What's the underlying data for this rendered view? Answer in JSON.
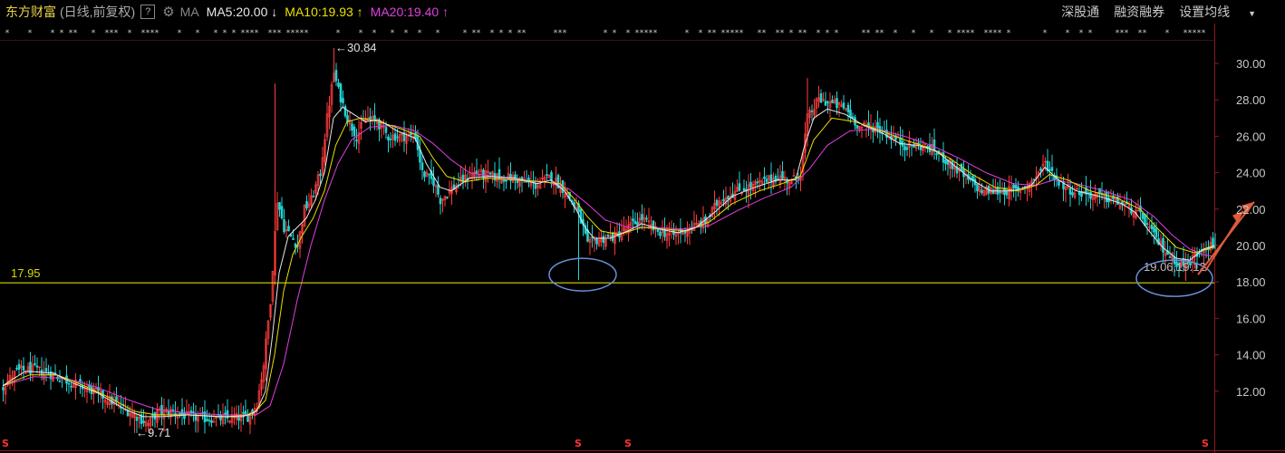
{
  "toolbar": {
    "stock_name": "东方财富",
    "mode": "(日线,前复权)",
    "help_label": "?",
    "ma_label": "MA",
    "ma5": "MA5:20.00",
    "ma5_arrow": "↓",
    "ma10": "MA10:19.93",
    "ma10_arrow": "↑",
    "ma20": "MA20:19.40",
    "ma20_arrow": "↑",
    "right_buttons": [
      "深股通",
      "融资融券",
      "设置均线"
    ],
    "dropdown_arrow": "▼",
    "gear_icon": "gear-icon"
  },
  "colors": {
    "up": "#ff3b3b",
    "down": "#22d3d3",
    "ma5": "#e8e8e8",
    "ma10": "#e8e000",
    "ma20": "#e040e0",
    "support_line": "#d8d800",
    "ellipse": "#6a8fd8",
    "arrow": "#e05a3a",
    "axis": "#8b1a1a"
  },
  "chart_data": {
    "type": "candlestick",
    "y_ticks": [
      "30.00",
      "28.00",
      "26.00",
      "24.00",
      "22.00",
      "20.00",
      "18.00",
      "16.00",
      "14.00",
      "12.00"
    ],
    "ylim": [
      10.6,
      32.0
    ],
    "grid": false,
    "support_level": 17.95,
    "support_label": "17.95",
    "max_annotation": {
      "label": "←30.84",
      "value": 30.84
    },
    "min_annotation": {
      "label": "←9.71",
      "value": 9.71
    },
    "right_annotation": "19.06,19.12",
    "ma_latest": {
      "MA5": 20.0,
      "MA10": 19.93,
      "MA20": 19.4
    },
    "close_anchors": [
      [
        0,
        12.3
      ],
      [
        6,
        13.1
      ],
      [
        14,
        13.2
      ],
      [
        22,
        12.9
      ],
      [
        30,
        12.5
      ],
      [
        40,
        12.0
      ],
      [
        50,
        11.3
      ],
      [
        58,
        10.7
      ],
      [
        64,
        10.2
      ],
      [
        68,
        10.8
      ],
      [
        74,
        10.9
      ],
      [
        82,
        10.6
      ],
      [
        90,
        10.5
      ],
      [
        100,
        10.5
      ],
      [
        108,
        10.6
      ],
      [
        112,
        11.3
      ],
      [
        115,
        13.5
      ],
      [
        118,
        17.0
      ],
      [
        121,
        22.5
      ],
      [
        124,
        21.0
      ],
      [
        127,
        20.5
      ],
      [
        130,
        20.0
      ],
      [
        133,
        22.0
      ],
      [
        136,
        22.5
      ],
      [
        140,
        24.0
      ],
      [
        143,
        27.0
      ],
      [
        146,
        29.5
      ],
      [
        148,
        28.5
      ],
      [
        152,
        27.0
      ],
      [
        156,
        26.0
      ],
      [
        160,
        27.0
      ],
      [
        165,
        26.8
      ],
      [
        170,
        26.0
      ],
      [
        176,
        26.0
      ],
      [
        182,
        26.0
      ],
      [
        185,
        24.0
      ],
      [
        190,
        23.5
      ],
      [
        193,
        22.5
      ],
      [
        197,
        23.0
      ],
      [
        202,
        23.5
      ],
      [
        208,
        24.0
      ],
      [
        216,
        23.8
      ],
      [
        225,
        23.7
      ],
      [
        235,
        23.3
      ],
      [
        242,
        23.8
      ],
      [
        248,
        23.0
      ],
      [
        253,
        22.0
      ],
      [
        256,
        21.0
      ],
      [
        258,
        20.0
      ],
      [
        262,
        20.3
      ],
      [
        270,
        20.5
      ],
      [
        276,
        21.0
      ],
      [
        282,
        21.5
      ],
      [
        288,
        20.8
      ],
      [
        296,
        20.6
      ],
      [
        304,
        21.0
      ],
      [
        310,
        21.3
      ],
      [
        316,
        22.5
      ],
      [
        324,
        23.0
      ],
      [
        334,
        23.4
      ],
      [
        342,
        23.8
      ],
      [
        348,
        23.5
      ],
      [
        352,
        24.0
      ],
      [
        355,
        27.0
      ],
      [
        360,
        28.0
      ],
      [
        366,
        27.8
      ],
      [
        372,
        27.5
      ],
      [
        378,
        26.5
      ],
      [
        385,
        26.5
      ],
      [
        392,
        26.0
      ],
      [
        398,
        25.5
      ],
      [
        404,
        25.5
      ],
      [
        410,
        25.3
      ],
      [
        418,
        24.5
      ],
      [
        425,
        23.7
      ],
      [
        432,
        23.0
      ],
      [
        440,
        23.0
      ],
      [
        448,
        23.0
      ],
      [
        454,
        23.5
      ],
      [
        460,
        24.5
      ],
      [
        466,
        23.5
      ],
      [
        472,
        23.0
      ],
      [
        480,
        22.8
      ],
      [
        490,
        22.5
      ],
      [
        498,
        22.0
      ],
      [
        503,
        21.5
      ],
      [
        508,
        20.5
      ],
      [
        513,
        19.7
      ],
      [
        518,
        19.1
      ],
      [
        522,
        18.9
      ],
      [
        526,
        19.4
      ],
      [
        530,
        20.0
      ],
      [
        535,
        20.0
      ]
    ],
    "ma5_anchors": [
      [
        0,
        12.3
      ],
      [
        10,
        13.1
      ],
      [
        22,
        13.0
      ],
      [
        32,
        12.4
      ],
      [
        42,
        11.9
      ],
      [
        54,
        11.0
      ],
      [
        62,
        10.6
      ],
      [
        70,
        10.6
      ],
      [
        82,
        10.7
      ],
      [
        96,
        10.6
      ],
      [
        106,
        10.6
      ],
      [
        112,
        10.9
      ],
      [
        116,
        12.0
      ],
      [
        119,
        15.0
      ],
      [
        122,
        18.5
      ],
      [
        126,
        20.5
      ],
      [
        130,
        21.0
      ],
      [
        134,
        21.5
      ],
      [
        138,
        22.5
      ],
      [
        142,
        24.0
      ],
      [
        146,
        27.0
      ],
      [
        150,
        27.6
      ],
      [
        155,
        27.2
      ],
      [
        160,
        26.8
      ],
      [
        166,
        26.9
      ],
      [
        174,
        26.3
      ],
      [
        182,
        25.9
      ],
      [
        187,
        24.5
      ],
      [
        193,
        23.2
      ],
      [
        198,
        23.0
      ],
      [
        206,
        23.7
      ],
      [
        215,
        23.8
      ],
      [
        226,
        23.7
      ],
      [
        236,
        23.4
      ],
      [
        242,
        23.6
      ],
      [
        248,
        23.0
      ],
      [
        253,
        22.0
      ],
      [
        257,
        21.0
      ],
      [
        261,
        20.4
      ],
      [
        268,
        20.4
      ],
      [
        276,
        20.8
      ],
      [
        282,
        21.2
      ],
      [
        290,
        20.9
      ],
      [
        298,
        20.7
      ],
      [
        306,
        21.0
      ],
      [
        314,
        21.8
      ],
      [
        322,
        22.7
      ],
      [
        332,
        23.2
      ],
      [
        342,
        23.6
      ],
      [
        350,
        23.6
      ],
      [
        354,
        25.5
      ],
      [
        358,
        27.0
      ],
      [
        364,
        27.5
      ],
      [
        372,
        27.2
      ],
      [
        380,
        26.6
      ],
      [
        388,
        26.2
      ],
      [
        396,
        25.6
      ],
      [
        404,
        25.5
      ],
      [
        412,
        25.2
      ],
      [
        420,
        24.4
      ],
      [
        428,
        23.6
      ],
      [
        436,
        23.0
      ],
      [
        446,
        23.0
      ],
      [
        454,
        23.3
      ],
      [
        460,
        24.3
      ],
      [
        466,
        23.6
      ],
      [
        474,
        23.0
      ],
      [
        484,
        22.7
      ],
      [
        494,
        22.3
      ],
      [
        500,
        21.8
      ],
      [
        506,
        20.8
      ],
      [
        512,
        19.9
      ],
      [
        518,
        19.3
      ],
      [
        524,
        19.2
      ],
      [
        530,
        19.8
      ],
      [
        535,
        20.0
      ]
    ],
    "ma10_anchors": [
      [
        0,
        12.3
      ],
      [
        12,
        12.9
      ],
      [
        24,
        12.9
      ],
      [
        36,
        12.3
      ],
      [
        48,
        11.6
      ],
      [
        58,
        10.9
      ],
      [
        68,
        10.7
      ],
      [
        82,
        10.7
      ],
      [
        98,
        10.6
      ],
      [
        110,
        10.7
      ],
      [
        116,
        11.5
      ],
      [
        120,
        14.0
      ],
      [
        124,
        17.5
      ],
      [
        128,
        19.5
      ],
      [
        132,
        20.5
      ],
      [
        137,
        21.5
      ],
      [
        142,
        23.0
      ],
      [
        147,
        25.5
      ],
      [
        152,
        26.8
      ],
      [
        158,
        27.0
      ],
      [
        166,
        26.8
      ],
      [
        176,
        26.4
      ],
      [
        184,
        26.0
      ],
      [
        190,
        24.8
      ],
      [
        196,
        23.8
      ],
      [
        204,
        23.5
      ],
      [
        214,
        23.7
      ],
      [
        226,
        23.6
      ],
      [
        238,
        23.5
      ],
      [
        246,
        23.4
      ],
      [
        252,
        22.6
      ],
      [
        258,
        21.6
      ],
      [
        264,
        20.8
      ],
      [
        272,
        20.6
      ],
      [
        282,
        21.0
      ],
      [
        292,
        20.9
      ],
      [
        302,
        20.8
      ],
      [
        312,
        21.3
      ],
      [
        322,
        22.3
      ],
      [
        334,
        23.0
      ],
      [
        344,
        23.4
      ],
      [
        352,
        23.8
      ],
      [
        358,
        25.8
      ],
      [
        366,
        27.0
      ],
      [
        376,
        26.8
      ],
      [
        388,
        26.3
      ],
      [
        398,
        25.8
      ],
      [
        408,
        25.4
      ],
      [
        418,
        24.8
      ],
      [
        428,
        23.9
      ],
      [
        438,
        23.2
      ],
      [
        448,
        23.0
      ],
      [
        456,
        23.3
      ],
      [
        462,
        23.9
      ],
      [
        470,
        23.6
      ],
      [
        480,
        23.0
      ],
      [
        492,
        22.6
      ],
      [
        502,
        22.0
      ],
      [
        510,
        20.9
      ],
      [
        518,
        19.9
      ],
      [
        526,
        19.6
      ],
      [
        535,
        19.93
      ]
    ],
    "ma20_anchors": [
      [
        0,
        12.3
      ],
      [
        14,
        12.8
      ],
      [
        28,
        12.7
      ],
      [
        42,
        12.2
      ],
      [
        56,
        11.5
      ],
      [
        68,
        11.0
      ],
      [
        82,
        10.8
      ],
      [
        98,
        10.7
      ],
      [
        112,
        10.7
      ],
      [
        118,
        11.2
      ],
      [
        124,
        13.5
      ],
      [
        130,
        17.0
      ],
      [
        136,
        20.0
      ],
      [
        142,
        22.5
      ],
      [
        148,
        24.5
      ],
      [
        154,
        25.8
      ],
      [
        162,
        26.5
      ],
      [
        172,
        26.6
      ],
      [
        182,
        26.3
      ],
      [
        190,
        25.6
      ],
      [
        198,
        24.7
      ],
      [
        206,
        24.0
      ],
      [
        216,
        23.8
      ],
      [
        228,
        23.6
      ],
      [
        240,
        23.5
      ],
      [
        250,
        23.1
      ],
      [
        258,
        22.3
      ],
      [
        266,
        21.4
      ],
      [
        276,
        21.0
      ],
      [
        288,
        21.0
      ],
      [
        300,
        20.9
      ],
      [
        312,
        21.1
      ],
      [
        324,
        21.9
      ],
      [
        336,
        22.6
      ],
      [
        348,
        23.2
      ],
      [
        356,
        24.2
      ],
      [
        364,
        25.5
      ],
      [
        374,
        26.3
      ],
      [
        386,
        26.4
      ],
      [
        398,
        26.0
      ],
      [
        410,
        25.5
      ],
      [
        422,
        24.8
      ],
      [
        434,
        24.0
      ],
      [
        446,
        23.4
      ],
      [
        456,
        23.3
      ],
      [
        464,
        23.6
      ],
      [
        474,
        23.4
      ],
      [
        486,
        23.0
      ],
      [
        498,
        22.5
      ],
      [
        508,
        21.6
      ],
      [
        516,
        20.6
      ],
      [
        524,
        19.8
      ],
      [
        530,
        19.5
      ],
      [
        535,
        19.4
      ]
    ],
    "markers": [
      1,
      246,
      268,
      530
    ],
    "marker_symbol": "S"
  }
}
